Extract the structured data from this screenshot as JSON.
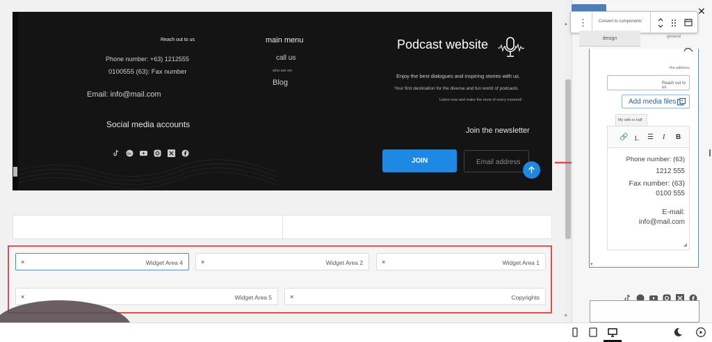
{
  "preview": {
    "reach_out": "Reach out to us",
    "phone": "Phone number: +63) 1212555",
    "fax": "0100555 (63): Fax number",
    "email": "Email: info@mail.com",
    "social": "Social media accounts",
    "main_menu": "main menu",
    "call_us": "call us",
    "who_we_are": "who are we",
    "blog": "Blog",
    "title": "Podcast website",
    "enjoy": "Enjoy the best dialogues and inspiring stories with us.",
    "first_dest": "Your first destination for the diverse and fun world of podcasts.",
    "listen": "Listen now and make the most of every moment!",
    "join_newsletter": "Join the newsletter",
    "join_button": "JOIN",
    "email_placeholder": "Email address"
  },
  "widgets": {
    "area4": "Widget Area 4",
    "area2": "Widget Area 2",
    "area1": "Widget Area 1",
    "area5": "Widget Area 5",
    "copyrights": "Copyrights",
    "remove": "×"
  },
  "toolbar": {
    "convert": "Convert to components"
  },
  "panel": {
    "tab_design": "design",
    "tab_second": "general",
    "the_address": "the address",
    "reach_out_input": "Reach out to us",
    "add_media": "Add media files",
    "editor_tab": "My wife is half",
    "editor_lines": [
      "Phone number: (63)",
      "1212 555",
      "Fax number: (63)",
      "0100 555",
      "E-mail:",
      "info@mail.com"
    ]
  },
  "colors": {
    "accent": "#1e88e5",
    "highlight_frame": "#d94e4e",
    "preview_bg": "#141414"
  }
}
